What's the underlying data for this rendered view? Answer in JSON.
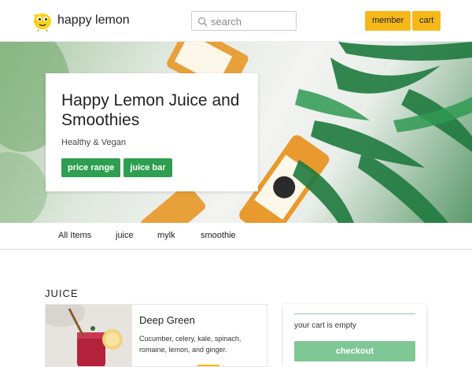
{
  "header": {
    "brand": "happy lemon",
    "search_placeholder": "search",
    "member_label": "member",
    "cart_label": "cart",
    "accent_color": "#f6b817"
  },
  "hero": {
    "title": "Happy Lemon Juice and Smoothies",
    "subtitle": "Healthy & Vegan",
    "tags": [
      "price range",
      "juice bar"
    ],
    "tag_color": "#2e9e4f"
  },
  "nav": {
    "items": [
      "All Items",
      "juice",
      "mylk",
      "smoothie"
    ]
  },
  "section": {
    "title": "JUICE"
  },
  "product": {
    "name": "Deep Green",
    "description": "Cucumber, celery, kale, spinach, romaine, lemon, and ginger."
  },
  "cart": {
    "empty_text": "your cart is empty",
    "checkout_label": "checkout",
    "checkout_color": "#80c796"
  },
  "icons": [
    "lemon-logo-icon",
    "search-icon"
  ]
}
